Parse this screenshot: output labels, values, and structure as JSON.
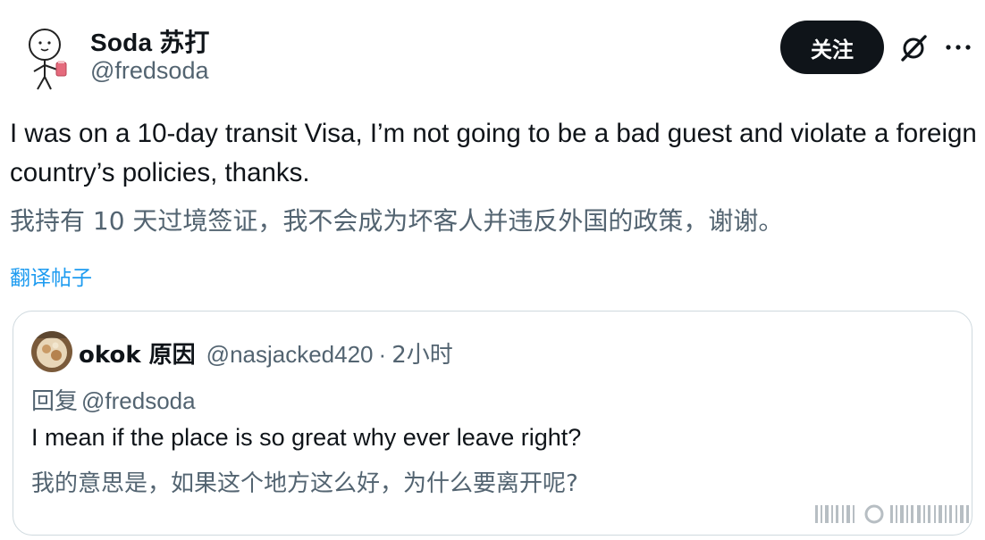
{
  "author": {
    "display_name": "Soda 苏打",
    "handle": "@fredsoda"
  },
  "actions": {
    "follow_label": "关注",
    "grok_icon": "grok-icon",
    "more_icon": "more-icon"
  },
  "tweet": {
    "text": "I was on a 10-day transit Visa, I’m not going to be a bad guest and violate a foreign country’s policies, thanks.",
    "translation": "我持有 10 天过境签证，我不会成为坏客人并违反外国的政策，谢谢。",
    "translate_link": "翻译帖子"
  },
  "quote": {
    "name": "okok 原因",
    "handle": "@nasjacked420",
    "separator": "·",
    "time": "2小时",
    "reply_label": "回复",
    "reply_target": "@fredsoda",
    "text": "I mean if the place is so great why ever leave right?",
    "translation": "我的意思是，如果这个地方这么好，为什么要离开呢?"
  },
  "colors": {
    "primary_text": "#0f1419",
    "secondary_text": "#536471",
    "link": "#1d9bf0",
    "border": "#cfd9de",
    "button_bg": "#0f1419"
  }
}
